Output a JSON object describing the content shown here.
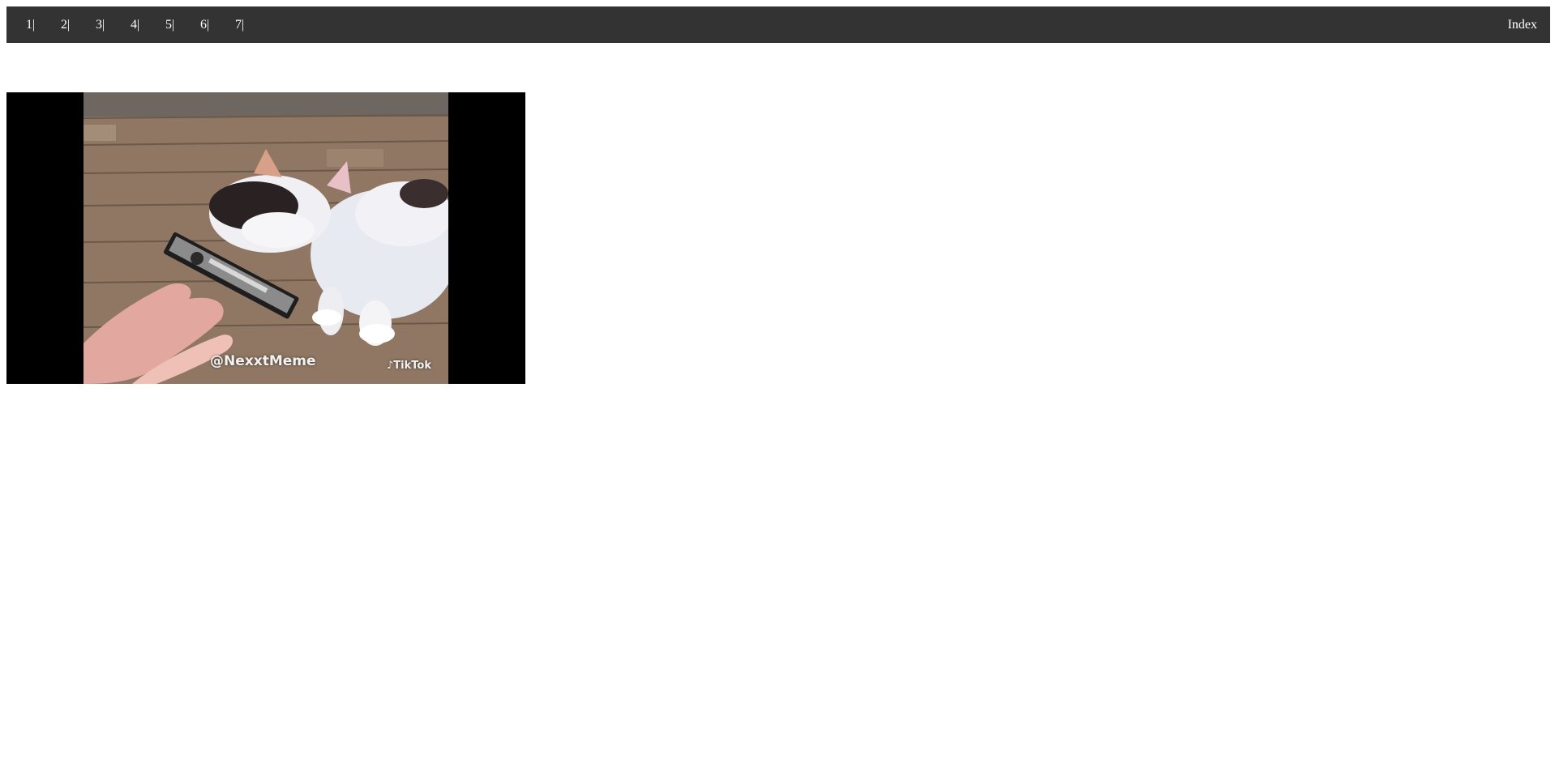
{
  "nav": {
    "links": [
      "1|",
      "2|",
      "3|",
      "4|",
      "5|",
      "6|",
      "7|"
    ],
    "index_label": "Index"
  },
  "video": {
    "watermark": "@NexxtMeme",
    "platform_label": "TikTok"
  },
  "colors": {
    "topbar_bg": "#333333",
    "topbar_text": "#ffffff",
    "video_letterbox": "#000000"
  }
}
